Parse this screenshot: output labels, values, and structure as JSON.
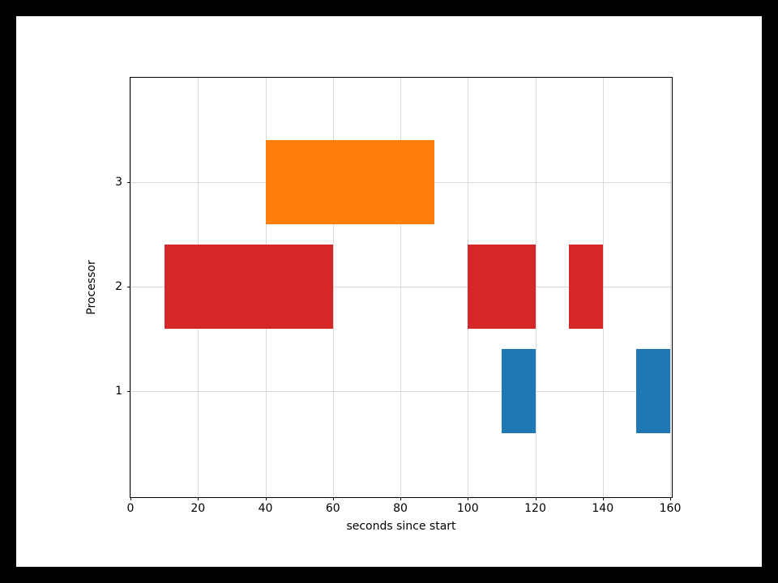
{
  "chart_data": {
    "type": "bar",
    "orientation": "horizontal_broken",
    "xlabel": "seconds since start",
    "ylabel": "Processor",
    "xlim": [
      0,
      160
    ],
    "ylim": [
      0,
      4
    ],
    "xticks": [
      0,
      20,
      40,
      60,
      80,
      100,
      120,
      140,
      160
    ],
    "yticks": [
      1,
      2,
      3
    ],
    "bar_height": 0.8,
    "series": [
      {
        "name": "Processor 1",
        "y": 1,
        "color": "#1f77b4",
        "intervals": [
          {
            "start": 110,
            "end": 120
          },
          {
            "start": 150,
            "end": 160
          }
        ]
      },
      {
        "name": "Processor 2",
        "y": 2,
        "color": "#d62728",
        "intervals": [
          {
            "start": 10,
            "end": 60
          },
          {
            "start": 100,
            "end": 120
          },
          {
            "start": 130,
            "end": 140
          }
        ]
      },
      {
        "name": "Processor 3",
        "y": 3,
        "color": "#ff7f0e",
        "intervals": [
          {
            "start": 40,
            "end": 90
          }
        ]
      }
    ]
  }
}
